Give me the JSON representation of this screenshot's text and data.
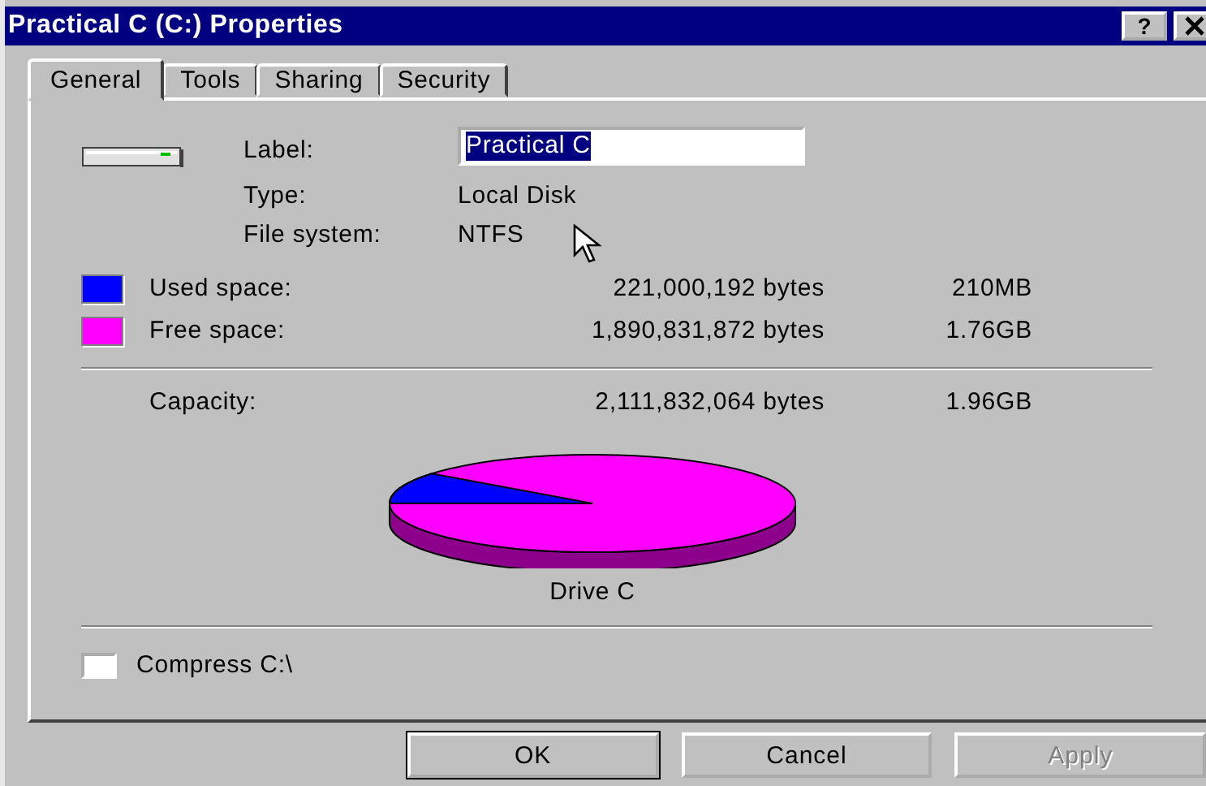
{
  "window": {
    "title": "Practical C (C:) Properties",
    "help": "?"
  },
  "tabs": [
    {
      "label": "General",
      "selected": true
    },
    {
      "label": "Tools",
      "selected": false
    },
    {
      "label": "Sharing",
      "selected": false
    },
    {
      "label": "Security",
      "selected": false
    }
  ],
  "label_field": {
    "label": "Label:",
    "value": "Practical C"
  },
  "info": [
    {
      "label": "Type:",
      "value": "Local Disk"
    },
    {
      "label": "File system:",
      "value": "NTFS"
    }
  ],
  "space": [
    {
      "label": "Used space:",
      "bytes": "221,000,192 bytes",
      "size": "210MB",
      "color": "#0000ff"
    },
    {
      "label": "Free space:",
      "bytes": "1,890,831,872 bytes",
      "size": "1.76GB",
      "color": "#ff00ff"
    }
  ],
  "capacity": {
    "label": "Capacity:",
    "bytes": "2,111,832,064 bytes",
    "size": "1.96GB"
  },
  "pie_caption": "Drive C",
  "compress": {
    "label": "Compress C:\\",
    "checked": false
  },
  "buttons": [
    {
      "label": "OK",
      "disabled": false,
      "default": true
    },
    {
      "label": "Cancel",
      "disabled": false,
      "default": false
    },
    {
      "label": "Apply",
      "disabled": true,
      "default": false
    }
  ]
}
